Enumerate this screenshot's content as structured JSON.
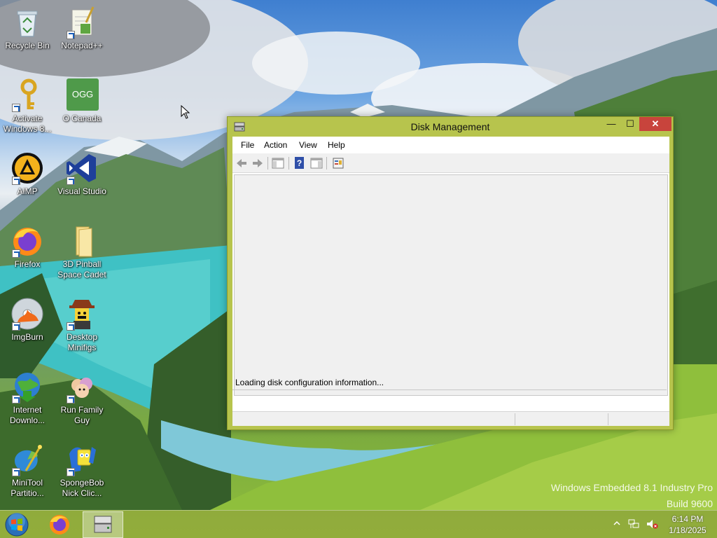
{
  "desktop": {
    "icons": [
      {
        "label": "Recycle Bin"
      },
      {
        "label": "Notepad++"
      },
      {
        "label": "Activate Windows 8..."
      },
      {
        "label": "O Canada",
        "badge": "OGG"
      },
      {
        "label": "AIMP"
      },
      {
        "label": "Visual Studio"
      },
      {
        "label": "Firefox"
      },
      {
        "label": "3D Pinball Space Cadet"
      },
      {
        "label": "ImgBurn"
      },
      {
        "label": "Desktop Minifigs"
      },
      {
        "label": "Internet Downlo..."
      },
      {
        "label": "Run Family Guy"
      },
      {
        "label": "MiniTool Partitio..."
      },
      {
        "label": "SpongeBob Nick Clic..."
      }
    ],
    "watermark_line1": "Windows Embedded 8.1 Industry Pro",
    "watermark_line2": "Build 9600"
  },
  "window": {
    "title": "Disk Management",
    "controls": {
      "minimize": "—",
      "maximize": "☐",
      "close": "✕"
    },
    "menu": [
      "File",
      "Action",
      "View",
      "Help"
    ],
    "toolbar": [
      "back-icon",
      "forward-icon",
      "show-hide-console-tree-icon",
      "help-icon",
      "show-hide-action-pane-icon",
      "properties-icon"
    ],
    "status_message": "Loading disk configuration information...",
    "accent_color": "#b7c44d"
  },
  "taskbar": {
    "apps": [
      "firefox-icon",
      "disk-management-icon"
    ],
    "clock": {
      "time": "6:14 PM",
      "date": "1/18/2025"
    }
  }
}
